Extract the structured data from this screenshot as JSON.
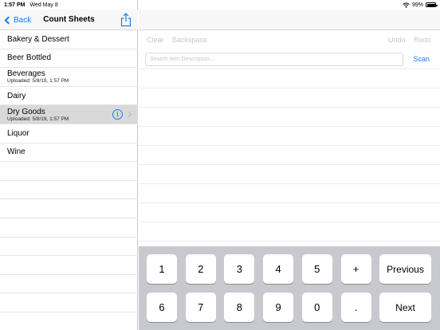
{
  "status_bar": {
    "time": "1:57 PM",
    "date": "Wed May 8",
    "battery": "99%",
    "icons": [
      "wifi-icon",
      "battery-icon"
    ]
  },
  "sidebar": {
    "back_label": "Back",
    "title": "Count Sheets",
    "share_icon": "share-icon",
    "items": [
      {
        "name": "Bakery & Dessert",
        "subtitle": "",
        "selected": false
      },
      {
        "name": "Beer Bottled",
        "subtitle": "",
        "selected": false
      },
      {
        "name": "Beverages",
        "subtitle": "Uploaded: 5/8/19, 1:57 PM",
        "selected": false
      },
      {
        "name": "Dairy",
        "subtitle": "",
        "selected": false
      },
      {
        "name": "Dry Goods",
        "subtitle": "Uploaded: 5/8/19, 1:57 PM",
        "selected": true
      },
      {
        "name": "Liquor",
        "subtitle": "",
        "selected": false
      },
      {
        "name": "Wine",
        "subtitle": "",
        "selected": false
      }
    ]
  },
  "toolbar": {
    "clear": "Clear",
    "backspace": "Backspace",
    "undo": "Undo",
    "redo": "Redo"
  },
  "search": {
    "placeholder": "Search Item Description...",
    "value": "",
    "scan_label": "Scan"
  },
  "keypad": {
    "row1": [
      "1",
      "2",
      "3",
      "4",
      "5",
      "+"
    ],
    "row2": [
      "6",
      "7",
      "8",
      "9",
      "0",
      "."
    ],
    "previous": "Previous",
    "next": "Next"
  },
  "colors": {
    "accent": "#1a7cf5",
    "selected_row": "#d9d9d9",
    "keypad_bg": "#c7c9ce",
    "disabled_text": "#c7c7cc"
  }
}
